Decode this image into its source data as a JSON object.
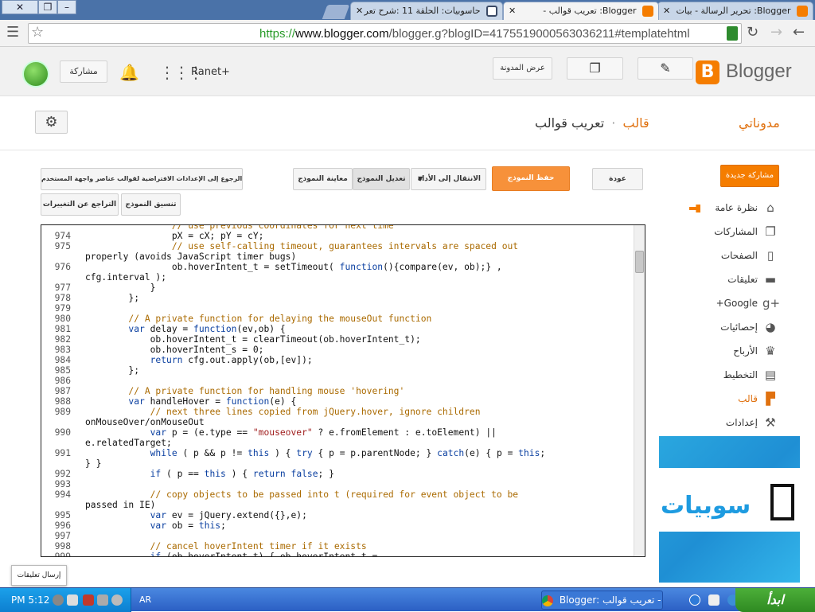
{
  "browser": {
    "window_buttons": [
      "✕",
      "❐",
      "–"
    ],
    "tabs": [
      {
        "title": "Blogger: تعريب قوالب -",
        "active": true
      },
      {
        "title": "حاسوبيات: الحلقة 11 :شرح تعر",
        "active": false
      },
      {
        "title": "Blogger: تحرير الرسالة - بيات",
        "active": false
      }
    ],
    "url": {
      "scheme": "https://",
      "host": "www.blogger.com",
      "path": "/blogger.g?blogID=417551900056303621​1#templatehtml"
    }
  },
  "header": {
    "logo_text": "Blogger",
    "logo_letter": "B",
    "edit_icon": "pencil-icon",
    "posts_icon": "copy-icon",
    "view_blog": "عرض المدونة",
    "ranet": "Ranet+",
    "share": "مشاركة"
  },
  "subheader": {
    "breadcrumb_root": "مدوناتي",
    "blog_name": "تعريب قوالب",
    "separator": "·",
    "section": "قالب"
  },
  "sidebar": {
    "new_post": "مشاركة جديدة",
    "items": [
      {
        "label": "نظرة عامة",
        "icon": "home-icon"
      },
      {
        "label": "المشاركات",
        "icon": "posts-icon"
      },
      {
        "label": "الصفحات",
        "icon": "page-icon"
      },
      {
        "label": "تعليقات",
        "icon": "comment-icon"
      },
      {
        "label": "Google+",
        "icon": "gplus-icon"
      },
      {
        "label": "إحصائيات",
        "icon": "pie-icon"
      },
      {
        "label": "الأرباح",
        "icon": "trophy-icon"
      },
      {
        "label": "التخطيط",
        "icon": "layout-icon"
      },
      {
        "label": "قالب",
        "icon": "paint-roller-icon",
        "active": true
      },
      {
        "label": "إعدادات",
        "icon": "wrench-icon"
      }
    ]
  },
  "actions": {
    "back": "عودة",
    "save": "حفظ النموذج",
    "jump": "الانتقال إلى الأداة",
    "edit": "تعديل النموذج",
    "preview": "معاينة النموذج",
    "revert_defaults": "الرجوع إلى الإعدادات الافتراضية لقوالب عناصر واجهة المستخدم",
    "undo": "التراجع عن التغييرات",
    "format": "تنسيق النموذج"
  },
  "code": [
    {
      "n": "",
      "t": "                // use previous coordinates for next time"
    },
    {
      "n": "974",
      "t": "                pX = cX; pY = cY;"
    },
    {
      "n": "975",
      "t": "                // use self-calling timeout, guarantees intervals are spaced out"
    },
    {
      "n": "",
      "t": "properly (avoids JavaScript timer bugs)"
    },
    {
      "n": "976",
      "t": "                ob.hoverIntent_t = setTimeout( function(){compare(ev, ob);} ,"
    },
    {
      "n": "",
      "t": "cfg.interval );"
    },
    {
      "n": "977",
      "t": "            }"
    },
    {
      "n": "978",
      "t": "        };"
    },
    {
      "n": "979",
      "t": ""
    },
    {
      "n": "980",
      "t": "        // A private function for delaying the mouseOut function"
    },
    {
      "n": "981",
      "t": "        var delay = function(ev,ob) {"
    },
    {
      "n": "982",
      "t": "            ob.hoverIntent_t = clearTimeout(ob.hoverIntent_t);"
    },
    {
      "n": "983",
      "t": "            ob.hoverIntent_s = 0;"
    },
    {
      "n": "984",
      "t": "            return cfg.out.apply(ob,[ev]);"
    },
    {
      "n": "985",
      "t": "        };"
    },
    {
      "n": "986",
      "t": ""
    },
    {
      "n": "987",
      "t": "        // A private function for handling mouse 'hovering'"
    },
    {
      "n": "988",
      "t": "        var handleHover = function(e) {"
    },
    {
      "n": "989",
      "t": "            // next three lines copied from jQuery.hover, ignore children"
    },
    {
      "n": "",
      "t": "onMouseOver/onMouseOut"
    },
    {
      "n": "990",
      "t": "            var p = (e.type == \"mouseover\" ? e.fromElement : e.toElement) ||"
    },
    {
      "n": "",
      "t": "e.relatedTarget;"
    },
    {
      "n": "991",
      "t": "            while ( p && p != this ) { try { p = p.parentNode; } catch(e) { p = this;"
    },
    {
      "n": "",
      "t": "} }"
    },
    {
      "n": "992",
      "t": "            if ( p == this ) { return false; }"
    },
    {
      "n": "993",
      "t": ""
    },
    {
      "n": "994",
      "t": "            // copy objects to be passed into t (required for event object to be"
    },
    {
      "n": "",
      "t": "passed in IE)"
    },
    {
      "n": "995",
      "t": "            var ev = jQuery.extend({},e);"
    },
    {
      "n": "996",
      "t": "            var ob = this;"
    },
    {
      "n": "997",
      "t": ""
    },
    {
      "n": "998",
      "t": "            // cancel hoverIntent timer if it exists"
    },
    {
      "n": "999",
      "t": "            if (ob.hoverIntent_t) { ob.hoverIntent_t ="
    }
  ],
  "promo": {
    "brand": "سوبيات"
  },
  "feedback": "إرسال تعليقات",
  "taskbar": {
    "clock": "PM 5:12",
    "lang": "AR",
    "task": "Blogger: تعريب قوالب - ...",
    "start": "ابدأ"
  },
  "colors": {
    "accent": "#f57d00",
    "active_nav": "#e0710f"
  }
}
